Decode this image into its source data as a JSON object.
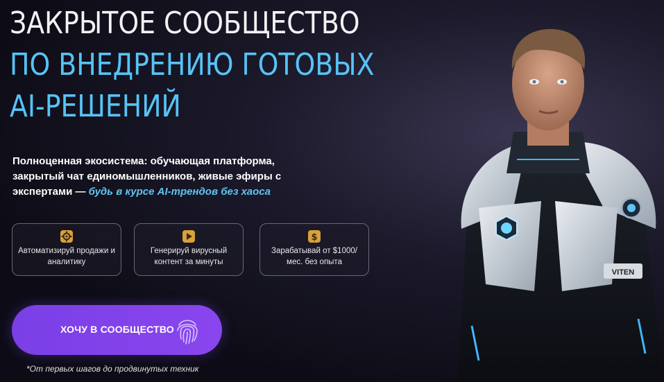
{
  "hero": {
    "title_line1": "ЗАКРЫТОЕ СООБЩЕСТВО",
    "title_line2": "ПО ВНЕДРЕНИЮ ГОТОВЫХ",
    "title_line3": "AI-РЕШЕНИЙ",
    "description_plain": "Полноценная экосистема: обучающая платформа, закрытый чат единомышленников, живые эфиры с экспертами —",
    "description_highlight": "будь в курсе AI-трендов без хаоса"
  },
  "features": [
    {
      "icon": "gear-icon",
      "text": "Автоматизируй продажи и аналитику"
    },
    {
      "icon": "play-icon",
      "text": "Генерируй вирусный контент за минуты"
    },
    {
      "icon": "dollar-icon",
      "text": "Зарабатывай от $1000/мес. без опыта"
    }
  ],
  "cta": {
    "label": "ХОЧУ В СООБЩЕСТВО",
    "icon": "fingerprint-icon"
  },
  "footnote": "*От первых шагов до продвинутых техник",
  "image": {
    "suit_badge": "VITEN"
  },
  "colors": {
    "accent_blue": "#57c3f5",
    "cta_purple": "#7a3fe6",
    "icon_gold": "#d9a13a"
  }
}
